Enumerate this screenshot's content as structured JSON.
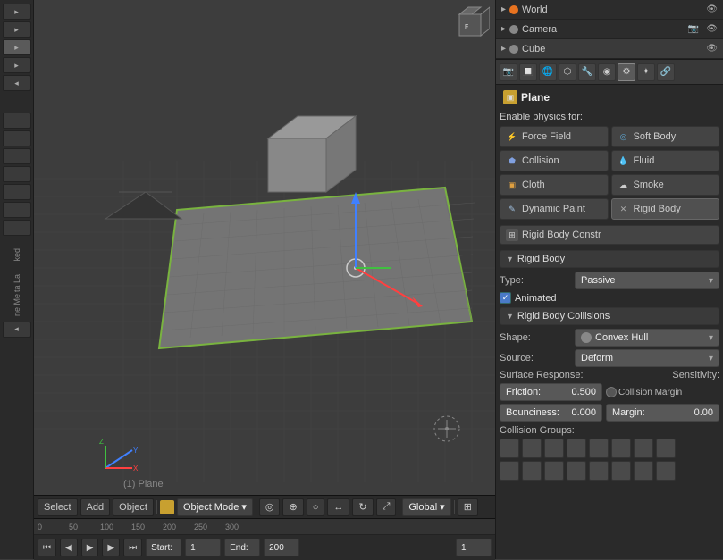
{
  "scene_list": {
    "items": [
      {
        "id": "world",
        "label": "World",
        "dot_color": "#e87320",
        "visible": true
      },
      {
        "id": "camera",
        "label": "Camera",
        "dot_color": "#888888",
        "visible": true
      },
      {
        "id": "cube",
        "label": "Cube",
        "dot_color": "#888888",
        "visible": true
      }
    ]
  },
  "object_header": {
    "icon_color": "#c8a030",
    "name": "Plane"
  },
  "enable_physics_label": "Enable physics for:",
  "physics_buttons": [
    {
      "id": "force-field",
      "label": "Force Field",
      "icon": "⚡",
      "icon_color": "#e8c840"
    },
    {
      "id": "soft-body",
      "label": "Soft Body",
      "icon": "◎",
      "icon_color": "#60b0e0"
    },
    {
      "id": "collision",
      "label": "Collision",
      "icon": "⬟",
      "icon_color": "#80a0e0"
    },
    {
      "id": "fluid",
      "label": "Fluid",
      "icon": "💧",
      "icon_color": "#60a0e0"
    },
    {
      "id": "cloth",
      "label": "Cloth",
      "icon": "▣",
      "icon_color": "#e0a040"
    },
    {
      "id": "smoke",
      "label": "Smoke",
      "icon": "☁",
      "icon_color": "#e0e0e0"
    },
    {
      "id": "dynamic-paint",
      "label": "Dynamic Paint",
      "icon": "✎",
      "icon_color": "#a0c0e0"
    },
    {
      "id": "rigid-body",
      "label": "Rigid Body",
      "icon": "✕",
      "icon_color": "#888888"
    }
  ],
  "rigid_body_constr_label": "Rigid Body Constr",
  "rigid_body_section": {
    "title": "Rigid Body",
    "type_label": "Type:",
    "type_value": "Passive",
    "animated_label": "Animated",
    "animated_checked": true
  },
  "rigid_body_collisions": {
    "title": "Rigid Body Collisions",
    "shape_label": "Shape:",
    "shape_value": "Convex Hull",
    "source_label": "Source:",
    "source_value": "Deform",
    "surface_response_label": "Surface Response:",
    "sensitivity_label": "Sensitivity:",
    "friction_label": "Friction:",
    "friction_value": "0.500",
    "collision_margin_label": "Collision Margin",
    "bounciness_label": "Bounciness:",
    "bounciness_value": "0.000",
    "margin_label": "Margin:",
    "margin_value": "0.00",
    "collision_groups_label": "Collision Groups:",
    "groups": [
      0,
      0,
      0,
      0,
      0,
      0,
      0,
      0,
      0,
      0,
      0,
      0,
      0,
      0,
      0,
      0
    ]
  },
  "viewport": {
    "label": "(1) Plane"
  },
  "toolbar": {
    "select_label": "Select",
    "add_label": "Add",
    "object_label": "Object",
    "mode_label": "Object Mode",
    "global_label": "Global"
  },
  "timeline": {
    "start_label": "Start:",
    "start_value": "1",
    "end_label": "End:",
    "end_value": "200",
    "current_frame": "1",
    "ruler_marks": [
      "0",
      "50",
      "100",
      "150",
      "200",
      "250",
      "300"
    ]
  },
  "icon_bar": {
    "icons": [
      "🌐",
      "📷",
      "⬡",
      "🔲",
      "🔷",
      "🔗",
      "🔧",
      "✦",
      "🔲"
    ]
  }
}
